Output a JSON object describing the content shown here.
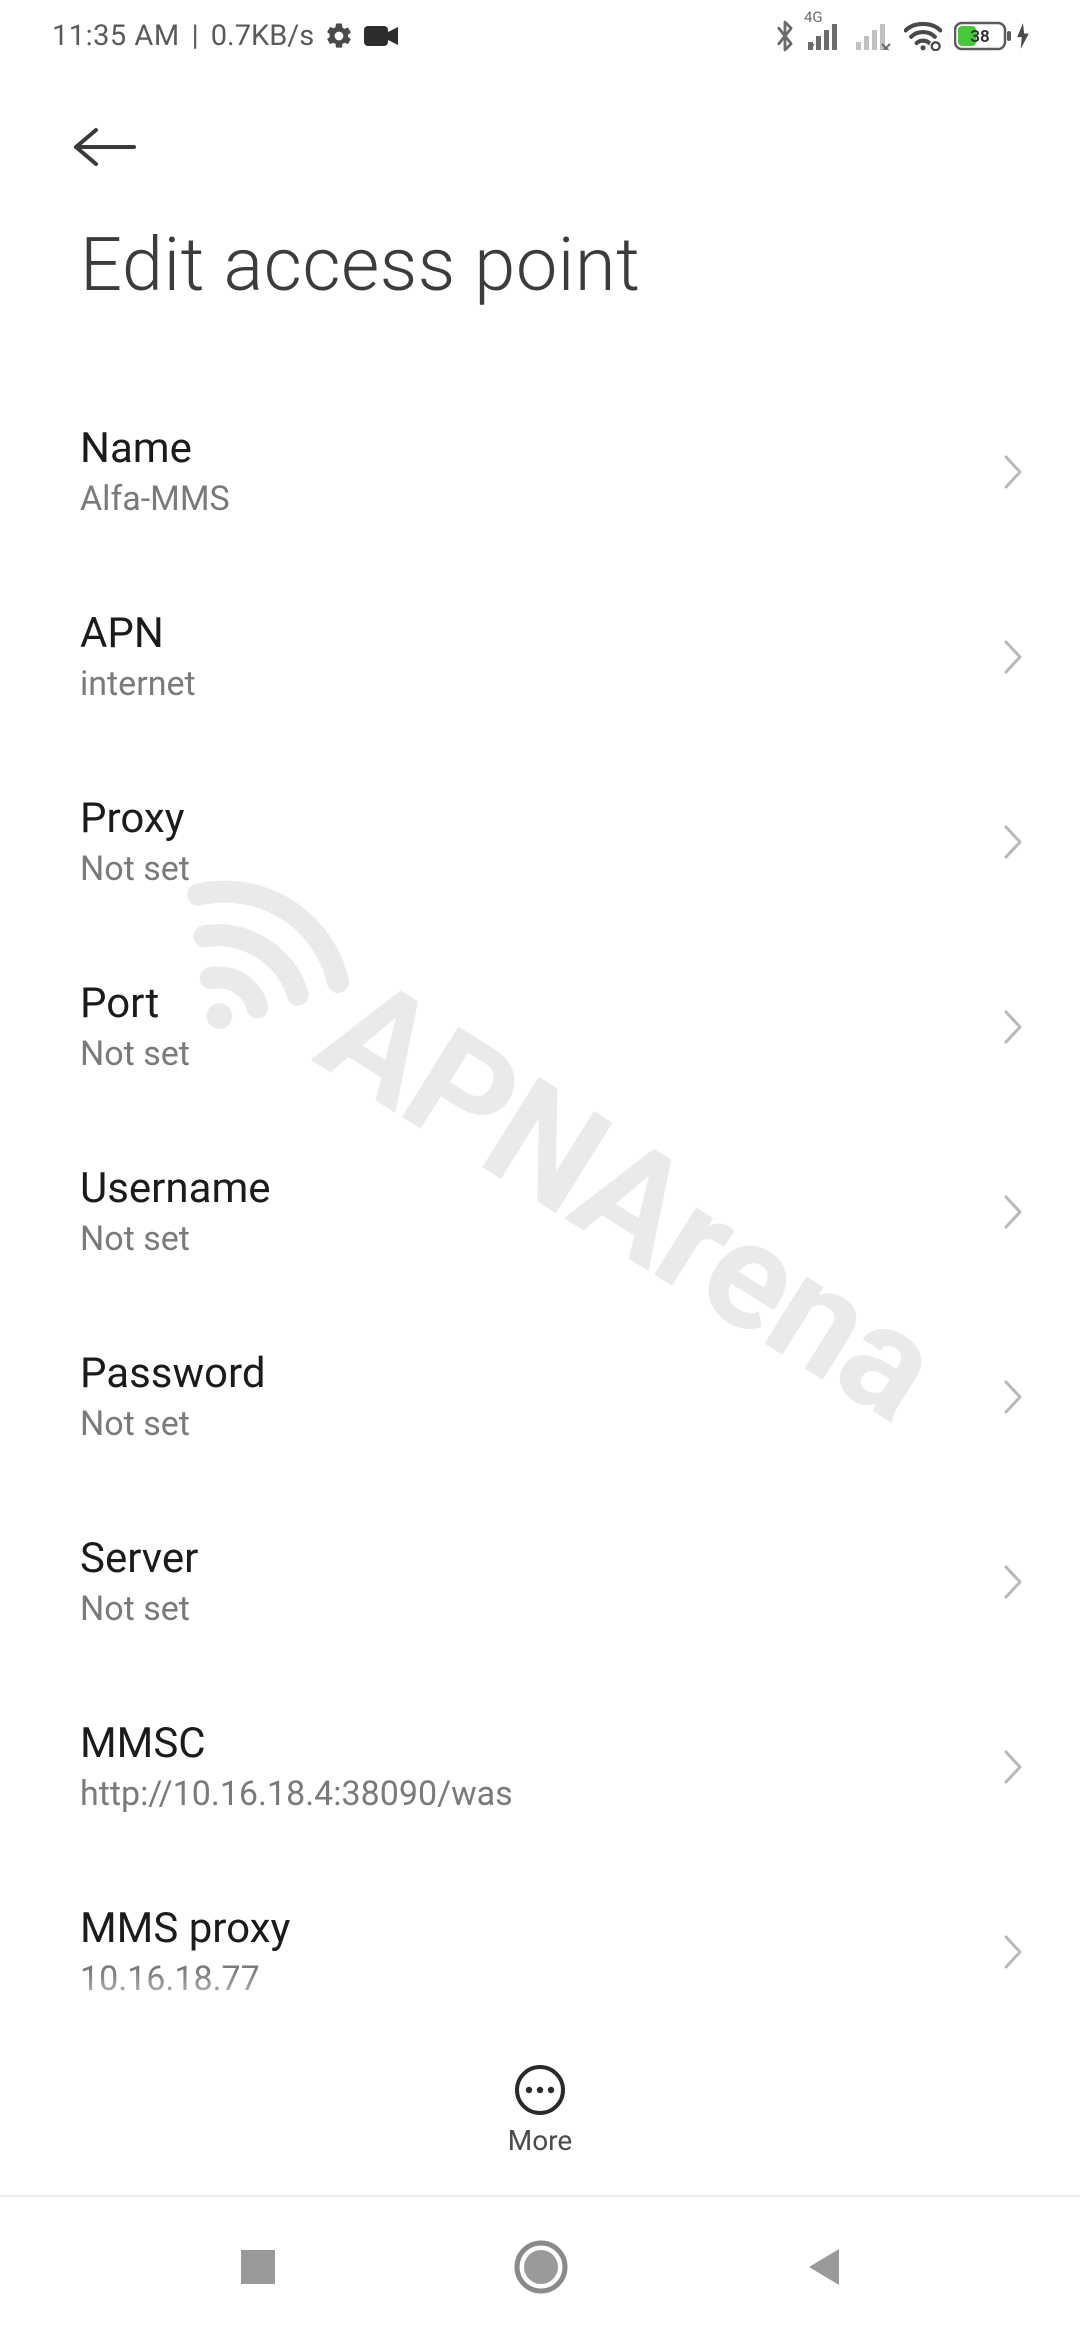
{
  "status": {
    "time": "11:35 AM",
    "speed": "0.7KB/s",
    "net_label": "4G",
    "battery_pct": "38"
  },
  "page_title": "Edit access point",
  "bottom": {
    "more_label": "More"
  },
  "watermark_text": "APNArena",
  "rows": {
    "0": {
      "label": "Name",
      "value": "Alfa-MMS"
    },
    "1": {
      "label": "APN",
      "value": "internet"
    },
    "2": {
      "label": "Proxy",
      "value": "Not set"
    },
    "3": {
      "label": "Port",
      "value": "Not set"
    },
    "4": {
      "label": "Username",
      "value": "Not set"
    },
    "5": {
      "label": "Password",
      "value": "Not set"
    },
    "6": {
      "label": "Server",
      "value": "Not set"
    },
    "7": {
      "label": "MMSC",
      "value": "http://10.16.18.4:38090/was"
    },
    "8": {
      "label": "MMS proxy",
      "value": "10.16.18.77"
    }
  }
}
